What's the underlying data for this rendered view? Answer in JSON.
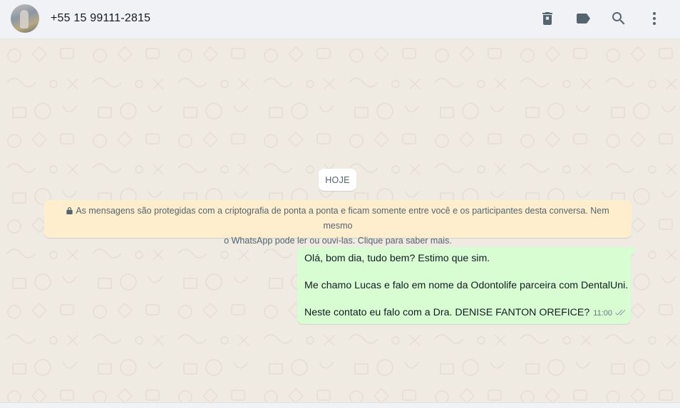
{
  "header": {
    "contact_name": "+55 15 99111-2815",
    "icons": [
      "delete-icon",
      "label-icon",
      "search-icon",
      "menu-icon"
    ]
  },
  "chat": {
    "date_chip": "HOJE",
    "encryption_notice": {
      "line1": "As mensagens são protegidas com a criptografia de ponta a ponta e ficam somente entre você e os participantes desta conversa. Nem mesmo",
      "line2": "o WhatsApp pode ler ou ouvi-las. Clique para saber mais."
    },
    "messages": [
      {
        "direction": "outgoing",
        "lines": [
          "Olá, bom dia, tudo bem? Estimo que sim.",
          "Me chamo Lucas e falo em nome da Odontolife parceira com DentalUni.",
          "Neste contato eu falo com a Dra. DENISE FANTON OREFICE?"
        ],
        "time": "11:00",
        "status": "delivered"
      }
    ]
  },
  "colors": {
    "header_bg": "#f0f2f5",
    "chat_bg": "#efeae2",
    "outgoing_bubble": "#d9fdd3",
    "system_notice": "#ffeecd",
    "icon": "#54656f"
  }
}
